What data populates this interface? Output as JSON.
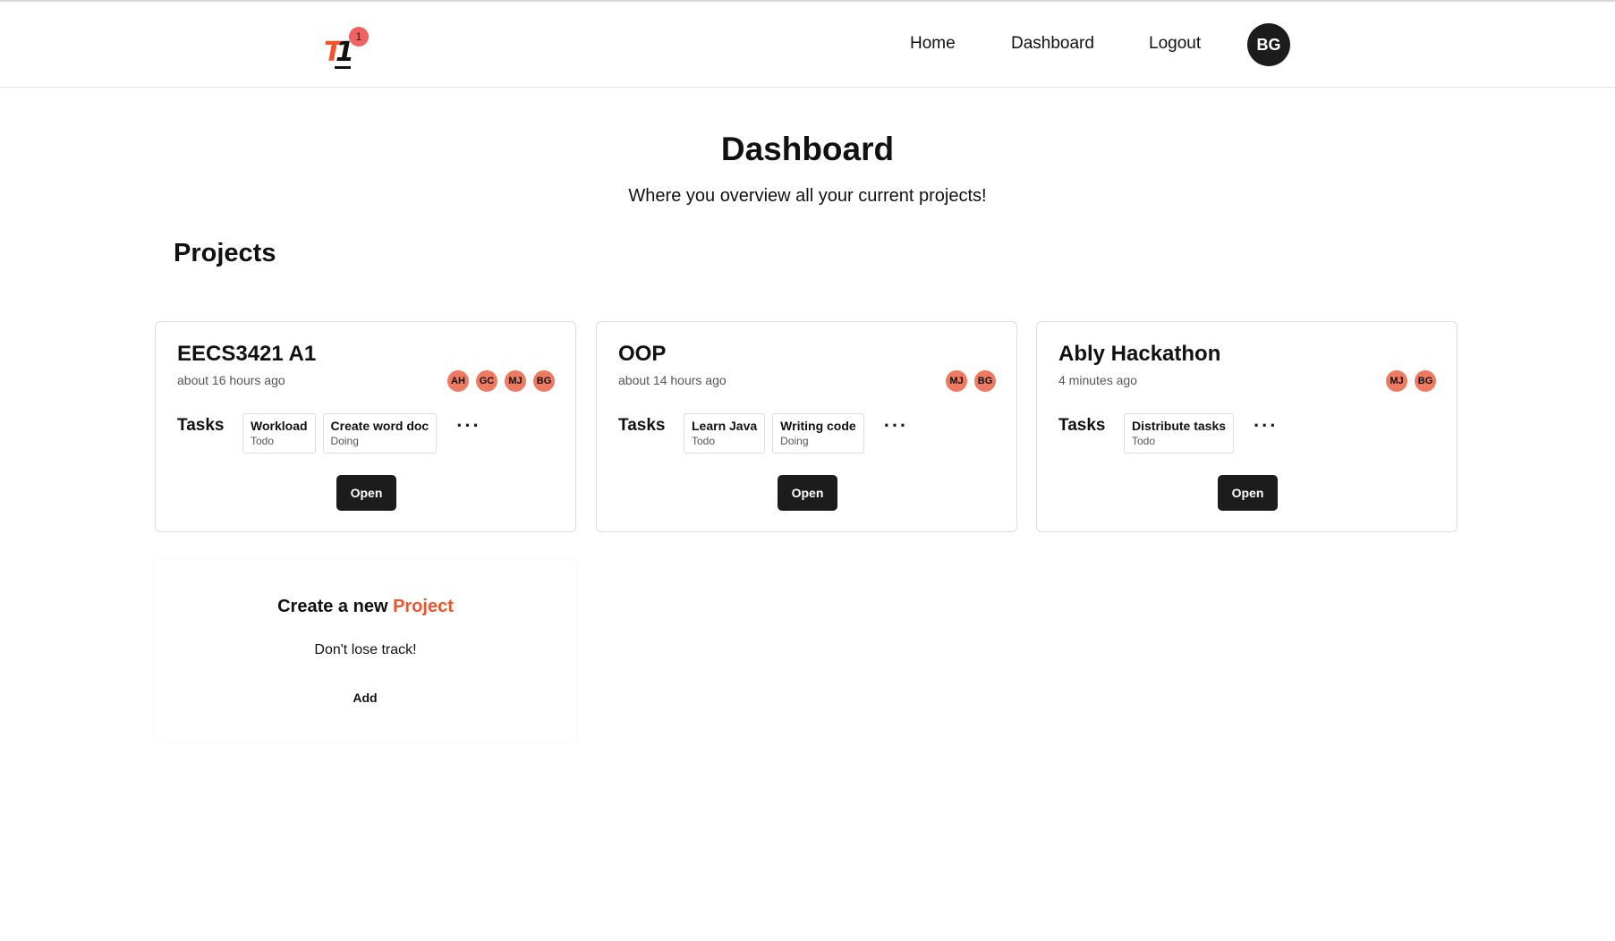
{
  "navbar": {
    "logo_text_1": "T",
    "logo_text_2": "1",
    "notification_count": "1",
    "links": {
      "home": "Home",
      "dashboard": "Dashboard",
      "logout": "Logout"
    },
    "user_initials": "BG"
  },
  "header": {
    "title": "Dashboard",
    "subtitle": "Where you overview all your current projects!"
  },
  "projects_section": {
    "title": "Projects",
    "tasks_label": "Tasks",
    "more_label": "...",
    "open_label": "Open",
    "projects": [
      {
        "name": "EECS3421 A1",
        "updated": "about 16 hours ago",
        "members": [
          "AH",
          "GC",
          "MJ",
          "BG"
        ],
        "tasks": [
          {
            "name": "Workload",
            "status": "Todo"
          },
          {
            "name": "Create word doc",
            "status": "Doing"
          }
        ]
      },
      {
        "name": "OOP",
        "updated": "about 14 hours ago",
        "members": [
          "MJ",
          "BG"
        ],
        "tasks": [
          {
            "name": "Learn Java",
            "status": "Todo"
          },
          {
            "name": "Writing code",
            "status": "Doing"
          }
        ]
      },
      {
        "name": "Ably Hackathon",
        "updated": "4 minutes ago",
        "members": [
          "MJ",
          "BG"
        ],
        "tasks": [
          {
            "name": "Distribute tasks",
            "status": "Todo"
          }
        ]
      }
    ]
  },
  "create_card": {
    "title_prefix": "Create a new ",
    "title_accent": "Project",
    "subtitle": "Don't lose track!",
    "add_label": "Add"
  },
  "colors": {
    "accent": "#f0522b",
    "avatar_bg": "#ef7a62",
    "button_bg": "#1c1c1c",
    "badge_bg": "#f06262"
  }
}
